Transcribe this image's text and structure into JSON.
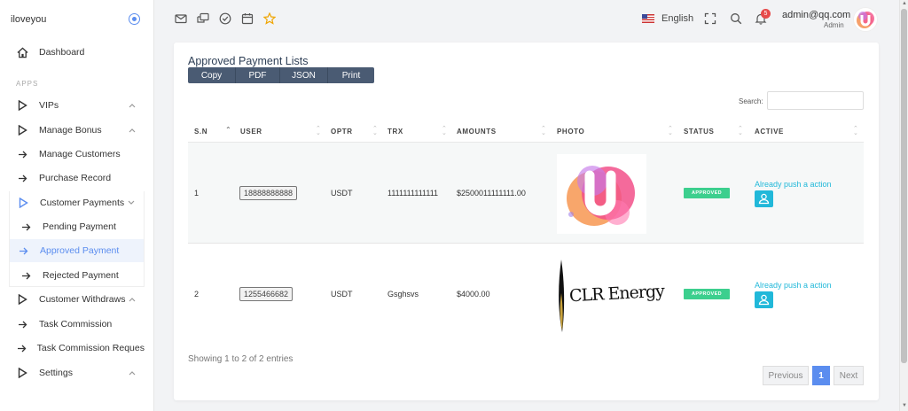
{
  "brand": {
    "name": "iloveyou"
  },
  "sidebar": {
    "dashboard": "Dashboard",
    "section": "APPS",
    "items": {
      "vips": "VIPs",
      "manage_bonus": "Manage Bonus",
      "manage_customers": "Manage Customers",
      "purchase_record": "Purchase Record",
      "customer_payments": "Customer Payments",
      "pending_payment": "Pending Payment",
      "approved_payment": "Approved Payment",
      "rejected_payment": "Rejected Payment",
      "customer_withdraws": "Customer Withdraws",
      "task_commission": "Task Commission",
      "task_commission_requests": "Task Commission Reques",
      "settings": "Settings"
    }
  },
  "topbar": {
    "language": "English",
    "notification_count": "5",
    "user_email": "admin@qq.com",
    "user_role": "Admin"
  },
  "card": {
    "title": "Approved Payment Lists",
    "buttons": {
      "copy": "Copy",
      "pdf": "PDF",
      "json": "JSON",
      "print": "Print"
    },
    "search_label": "Search:",
    "columns": [
      "S.N",
      "USER",
      "OPTR",
      "TRX",
      "AMOUNTS",
      "PHOTO",
      "STATUS",
      "ACTIVE"
    ],
    "rows": [
      {
        "sn": "1",
        "user": "18888888888",
        "optr": "USDT",
        "trx": "1111111111111",
        "amount": "$2500011111111.00",
        "status": "APPROVED",
        "active": "Already push a action"
      },
      {
        "sn": "2",
        "user": "1255466682",
        "optr": "USDT",
        "trx": "Gsghsvs",
        "amount": "$4000.00",
        "status": "APPROVED",
        "active": "Already push a action"
      }
    ],
    "photo2_text": "CLR Energy",
    "info": "Showing 1 to 2 of 2 entries",
    "pager": {
      "prev": "Previous",
      "current": "1",
      "next": "Next"
    }
  },
  "colors": {
    "accent": "#5b8def",
    "status_green": "#3ccf8e",
    "action_cyan": "#21b8d9",
    "button_dark": "#4a5b73"
  }
}
